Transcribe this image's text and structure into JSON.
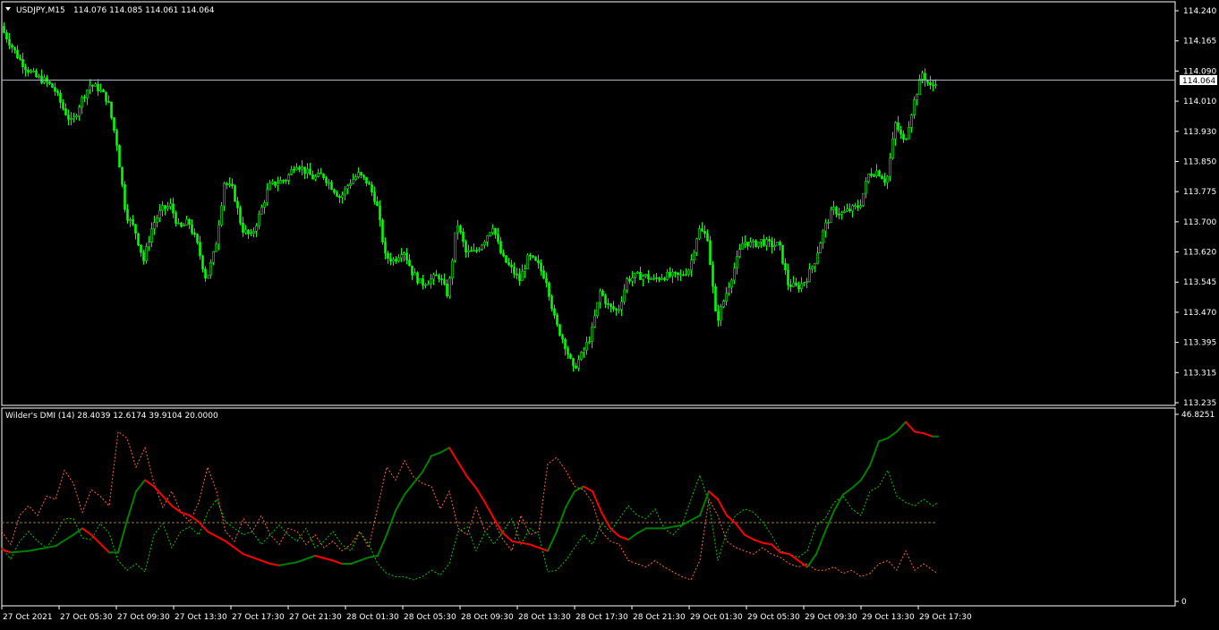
{
  "main_panel": {
    "symbol_label": "USDJPY,M15",
    "ohlc_label": "114.076 114.085 114.061 114.064",
    "current_price_label": "114.064",
    "price_axis_ticks": [
      "114.240",
      "114.165",
      "114.090",
      "114.010",
      "113.930",
      "113.850",
      "113.775",
      "113.700",
      "113.620",
      "113.545",
      "113.470",
      "113.395",
      "113.315",
      "113.235"
    ]
  },
  "indicator_panel": {
    "title": "Wilder's DMI (14) 28.4039 12.6174 39.9104 20.0000",
    "axis_ticks": [
      "46.8251",
      "0"
    ]
  },
  "time_axis": {
    "labels": [
      "27 Oct 2021",
      "27 Oct 05:30",
      "27 Oct 09:30",
      "27 Oct 13:30",
      "27 Oct 17:30",
      "27 Oct 21:30",
      "28 Oct 01:30",
      "28 Oct 05:30",
      "28 Oct 09:30",
      "28 Oct 13:30",
      "28 Oct 17:30",
      "28 Oct 21:30",
      "29 Oct 01:30",
      "29 Oct 05:30",
      "29 Oct 09:30",
      "29 Oct 13:30",
      "29 Oct 17:30"
    ]
  },
  "colors": {
    "background": "#000000",
    "frame": "#ffffff",
    "candle": "#00ff00",
    "adx_rising": "#008000",
    "adx_falling": "#ff0000",
    "plus_di": "#00cc00",
    "minus_di": "#ff6347",
    "level_line": "#8b7d3a"
  },
  "chart_data": {
    "type": "line",
    "close_path": [
      [
        0,
        114.2
      ],
      [
        10,
        114.16
      ],
      [
        20,
        114.12
      ],
      [
        30,
        114.09
      ],
      [
        40,
        114.07
      ],
      [
        50,
        114.06
      ],
      [
        60,
        114.04
      ],
      [
        70,
        113.99
      ],
      [
        80,
        113.95
      ],
      [
        90,
        114.01
      ],
      [
        100,
        114.05
      ],
      [
        110,
        114.04
      ],
      [
        120,
        114.01
      ],
      [
        130,
        113.9
      ],
      [
        140,
        113.72
      ],
      [
        150,
        113.68
      ],
      [
        160,
        113.6
      ],
      [
        170,
        113.69
      ],
      [
        180,
        113.73
      ],
      [
        190,
        113.74
      ],
      [
        200,
        113.68
      ],
      [
        210,
        113.7
      ],
      [
        220,
        113.64
      ],
      [
        230,
        113.55
      ],
      [
        240,
        113.63
      ],
      [
        250,
        113.8
      ],
      [
        260,
        113.78
      ],
      [
        270,
        113.68
      ],
      [
        280,
        113.66
      ],
      [
        290,
        113.72
      ],
      [
        300,
        113.79
      ],
      [
        310,
        113.8
      ],
      [
        320,
        113.81
      ],
      [
        330,
        113.85
      ],
      [
        340,
        113.83
      ],
      [
        350,
        113.81
      ],
      [
        360,
        113.82
      ],
      [
        370,
        113.79
      ],
      [
        380,
        113.76
      ],
      [
        390,
        113.8
      ],
      [
        400,
        113.82
      ],
      [
        410,
        113.8
      ],
      [
        420,
        113.75
      ],
      [
        430,
        113.61
      ],
      [
        440,
        113.6
      ],
      [
        450,
        113.63
      ],
      [
        460,
        113.57
      ],
      [
        470,
        113.54
      ],
      [
        480,
        113.55
      ],
      [
        490,
        113.56
      ],
      [
        500,
        113.51
      ],
      [
        510,
        113.7
      ],
      [
        520,
        113.62
      ],
      [
        530,
        113.62
      ],
      [
        540,
        113.65
      ],
      [
        550,
        113.69
      ],
      [
        560,
        113.61
      ],
      [
        570,
        113.58
      ],
      [
        580,
        113.55
      ],
      [
        590,
        113.61
      ],
      [
        600,
        113.59
      ],
      [
        610,
        113.55
      ],
      [
        620,
        113.44
      ],
      [
        630,
        113.39
      ],
      [
        640,
        113.32
      ],
      [
        650,
        113.36
      ],
      [
        660,
        113.41
      ],
      [
        670,
        113.52
      ],
      [
        680,
        113.48
      ],
      [
        690,
        113.47
      ],
      [
        700,
        113.55
      ],
      [
        710,
        113.56
      ],
      [
        720,
        113.56
      ],
      [
        730,
        113.55
      ],
      [
        740,
        113.56
      ],
      [
        750,
        113.56
      ],
      [
        760,
        113.56
      ],
      [
        770,
        113.58
      ],
      [
        780,
        113.68
      ],
      [
        790,
        113.66
      ],
      [
        800,
        113.44
      ],
      [
        810,
        113.51
      ],
      [
        820,
        113.58
      ],
      [
        830,
        113.65
      ],
      [
        840,
        113.64
      ],
      [
        850,
        113.65
      ],
      [
        860,
        113.64
      ],
      [
        870,
        113.64
      ],
      [
        880,
        113.54
      ],
      [
        890,
        113.53
      ],
      [
        900,
        113.55
      ],
      [
        910,
        113.6
      ],
      [
        920,
        113.68
      ],
      [
        930,
        113.73
      ],
      [
        940,
        113.72
      ],
      [
        950,
        113.73
      ],
      [
        960,
        113.74
      ],
      [
        970,
        113.82
      ],
      [
        980,
        113.83
      ],
      [
        990,
        113.8
      ],
      [
        1000,
        113.95
      ],
      [
        1010,
        113.9
      ],
      [
        1020,
        114.0
      ],
      [
        1030,
        114.08
      ],
      [
        1040,
        114.04
      ],
      [
        1046,
        114.064
      ]
    ],
    "adx": [
      [
        0,
        0.19
      ],
      [
        10,
        0.17
      ],
      [
        30,
        0.18
      ],
      [
        60,
        0.21
      ],
      [
        80,
        0.28
      ],
      [
        90,
        0.32
      ],
      [
        100,
        0.28
      ],
      [
        120,
        0.17
      ],
      [
        130,
        0.17
      ],
      [
        140,
        0.37
      ],
      [
        150,
        0.55
      ],
      [
        160,
        0.62
      ],
      [
        170,
        0.58
      ],
      [
        180,
        0.52
      ],
      [
        190,
        0.46
      ],
      [
        200,
        0.42
      ],
      [
        210,
        0.4
      ],
      [
        220,
        0.36
      ],
      [
        230,
        0.3
      ],
      [
        250,
        0.24
      ],
      [
        270,
        0.16
      ],
      [
        290,
        0.12
      ],
      [
        300,
        0.1
      ],
      [
        310,
        0.09
      ],
      [
        330,
        0.11
      ],
      [
        350,
        0.15
      ],
      [
        370,
        0.12
      ],
      [
        380,
        0.1
      ],
      [
        390,
        0.1
      ],
      [
        410,
        0.14
      ],
      [
        420,
        0.15
      ],
      [
        430,
        0.28
      ],
      [
        440,
        0.43
      ],
      [
        450,
        0.53
      ],
      [
        460,
        0.6
      ],
      [
        470,
        0.67
      ],
      [
        480,
        0.77
      ],
      [
        490,
        0.79
      ],
      [
        500,
        0.82
      ],
      [
        510,
        0.73
      ],
      [
        520,
        0.64
      ],
      [
        530,
        0.57
      ],
      [
        540,
        0.48
      ],
      [
        550,
        0.38
      ],
      [
        560,
        0.29
      ],
      [
        570,
        0.24
      ],
      [
        590,
        0.22
      ],
      [
        600,
        0.2
      ],
      [
        610,
        0.18
      ],
      [
        620,
        0.3
      ],
      [
        630,
        0.45
      ],
      [
        640,
        0.55
      ],
      [
        650,
        0.58
      ],
      [
        660,
        0.55
      ],
      [
        670,
        0.42
      ],
      [
        680,
        0.32
      ],
      [
        690,
        0.27
      ],
      [
        700,
        0.25
      ],
      [
        710,
        0.29
      ],
      [
        720,
        0.32
      ],
      [
        740,
        0.32
      ],
      [
        760,
        0.34
      ],
      [
        780,
        0.4
      ],
      [
        790,
        0.55
      ],
      [
        800,
        0.5
      ],
      [
        810,
        0.4
      ],
      [
        820,
        0.35
      ],
      [
        830,
        0.28
      ],
      [
        840,
        0.25
      ],
      [
        850,
        0.23
      ],
      [
        860,
        0.22
      ],
      [
        870,
        0.17
      ],
      [
        880,
        0.16
      ],
      [
        890,
        0.12
      ],
      [
        900,
        0.08
      ],
      [
        910,
        0.16
      ],
      [
        920,
        0.3
      ],
      [
        930,
        0.43
      ],
      [
        940,
        0.53
      ],
      [
        950,
        0.57
      ],
      [
        960,
        0.62
      ],
      [
        970,
        0.71
      ],
      [
        980,
        0.86
      ],
      [
        990,
        0.88
      ],
      [
        1000,
        0.92
      ],
      [
        1010,
        0.98
      ],
      [
        1020,
        0.92
      ],
      [
        1030,
        0.91
      ],
      [
        1040,
        0.89
      ],
      [
        1046,
        0.89
      ]
    ],
    "plus_di": [
      [
        0,
        0.2
      ],
      [
        10,
        0.13
      ],
      [
        20,
        0.24
      ],
      [
        30,
        0.3
      ],
      [
        40,
        0.24
      ],
      [
        50,
        0.2
      ],
      [
        60,
        0.28
      ],
      [
        70,
        0.38
      ],
      [
        80,
        0.38
      ],
      [
        90,
        0.26
      ],
      [
        100,
        0.25
      ],
      [
        110,
        0.35
      ],
      [
        120,
        0.29
      ],
      [
        130,
        0.12
      ],
      [
        140,
        0.06
      ],
      [
        150,
        0.1
      ],
      [
        160,
        0.05
      ],
      [
        170,
        0.28
      ],
      [
        180,
        0.35
      ],
      [
        190,
        0.2
      ],
      [
        200,
        0.3
      ],
      [
        210,
        0.33
      ],
      [
        220,
        0.28
      ],
      [
        230,
        0.42
      ],
      [
        240,
        0.5
      ],
      [
        250,
        0.36
      ],
      [
        260,
        0.32
      ],
      [
        270,
        0.28
      ],
      [
        280,
        0.3
      ],
      [
        290,
        0.22
      ],
      [
        300,
        0.28
      ],
      [
        310,
        0.34
      ],
      [
        320,
        0.28
      ],
      [
        330,
        0.24
      ],
      [
        340,
        0.32
      ],
      [
        350,
        0.2
      ],
      [
        360,
        0.24
      ],
      [
        370,
        0.3
      ],
      [
        380,
        0.22
      ],
      [
        390,
        0.18
      ],
      [
        400,
        0.3
      ],
      [
        410,
        0.22
      ],
      [
        420,
        0.1
      ],
      [
        430,
        0.04
      ],
      [
        440,
        0.02
      ],
      [
        450,
        0.02
      ],
      [
        460,
        0.0
      ],
      [
        470,
        0.02
      ],
      [
        480,
        0.06
      ],
      [
        490,
        0.03
      ],
      [
        500,
        0.1
      ],
      [
        510,
        0.3
      ],
      [
        520,
        0.33
      ],
      [
        530,
        0.18
      ],
      [
        540,
        0.3
      ],
      [
        550,
        0.22
      ],
      [
        560,
        0.3
      ],
      [
        570,
        0.38
      ],
      [
        580,
        0.22
      ],
      [
        590,
        0.32
      ],
      [
        600,
        0.28
      ],
      [
        610,
        0.05
      ],
      [
        620,
        0.06
      ],
      [
        630,
        0.12
      ],
      [
        640,
        0.2
      ],
      [
        650,
        0.28
      ],
      [
        660,
        0.22
      ],
      [
        670,
        0.35
      ],
      [
        680,
        0.3
      ],
      [
        690,
        0.38
      ],
      [
        700,
        0.46
      ],
      [
        710,
        0.4
      ],
      [
        720,
        0.38
      ],
      [
        730,
        0.44
      ],
      [
        740,
        0.32
      ],
      [
        750,
        0.28
      ],
      [
        760,
        0.34
      ],
      [
        770,
        0.5
      ],
      [
        780,
        0.65
      ],
      [
        790,
        0.48
      ],
      [
        800,
        0.12
      ],
      [
        810,
        0.3
      ],
      [
        820,
        0.4
      ],
      [
        830,
        0.44
      ],
      [
        840,
        0.42
      ],
      [
        850,
        0.36
      ],
      [
        860,
        0.28
      ],
      [
        870,
        0.18
      ],
      [
        880,
        0.16
      ],
      [
        890,
        0.14
      ],
      [
        900,
        0.18
      ],
      [
        910,
        0.34
      ],
      [
        920,
        0.38
      ],
      [
        930,
        0.48
      ],
      [
        940,
        0.52
      ],
      [
        950,
        0.44
      ],
      [
        960,
        0.4
      ],
      [
        970,
        0.55
      ],
      [
        980,
        0.58
      ],
      [
        990,
        0.68
      ],
      [
        1000,
        0.52
      ],
      [
        1010,
        0.48
      ],
      [
        1020,
        0.46
      ],
      [
        1030,
        0.5
      ],
      [
        1040,
        0.46
      ],
      [
        1046,
        0.48
      ]
    ],
    "minus_di": [
      [
        0,
        0.3
      ],
      [
        10,
        0.22
      ],
      [
        20,
        0.4
      ],
      [
        30,
        0.46
      ],
      [
        40,
        0.4
      ],
      [
        50,
        0.52
      ],
      [
        60,
        0.5
      ],
      [
        70,
        0.68
      ],
      [
        80,
        0.6
      ],
      [
        90,
        0.42
      ],
      [
        100,
        0.56
      ],
      [
        110,
        0.52
      ],
      [
        120,
        0.46
      ],
      [
        130,
        0.92
      ],
      [
        140,
        0.88
      ],
      [
        150,
        0.7
      ],
      [
        160,
        0.82
      ],
      [
        170,
        0.6
      ],
      [
        180,
        0.45
      ],
      [
        190,
        0.55
      ],
      [
        200,
        0.42
      ],
      [
        210,
        0.36
      ],
      [
        220,
        0.48
      ],
      [
        230,
        0.7
      ],
      [
        240,
        0.55
      ],
      [
        250,
        0.3
      ],
      [
        260,
        0.24
      ],
      [
        270,
        0.38
      ],
      [
        280,
        0.3
      ],
      [
        290,
        0.4
      ],
      [
        300,
        0.28
      ],
      [
        310,
        0.22
      ],
      [
        320,
        0.32
      ],
      [
        330,
        0.3
      ],
      [
        340,
        0.22
      ],
      [
        350,
        0.28
      ],
      [
        360,
        0.2
      ],
      [
        370,
        0.24
      ],
      [
        380,
        0.18
      ],
      [
        390,
        0.22
      ],
      [
        400,
        0.3
      ],
      [
        410,
        0.2
      ],
      [
        420,
        0.45
      ],
      [
        430,
        0.7
      ],
      [
        440,
        0.62
      ],
      [
        450,
        0.74
      ],
      [
        460,
        0.64
      ],
      [
        470,
        0.6
      ],
      [
        480,
        0.58
      ],
      [
        490,
        0.44
      ],
      [
        500,
        0.55
      ],
      [
        510,
        0.32
      ],
      [
        520,
        0.28
      ],
      [
        530,
        0.45
      ],
      [
        540,
        0.3
      ],
      [
        550,
        0.36
      ],
      [
        560,
        0.25
      ],
      [
        570,
        0.18
      ],
      [
        580,
        0.4
      ],
      [
        590,
        0.28
      ],
      [
        600,
        0.3
      ],
      [
        610,
        0.72
      ],
      [
        620,
        0.76
      ],
      [
        630,
        0.68
      ],
      [
        640,
        0.58
      ],
      [
        650,
        0.56
      ],
      [
        660,
        0.48
      ],
      [
        670,
        0.3
      ],
      [
        680,
        0.24
      ],
      [
        690,
        0.22
      ],
      [
        700,
        0.12
      ],
      [
        710,
        0.1
      ],
      [
        720,
        0.08
      ],
      [
        730,
        0.12
      ],
      [
        740,
        0.08
      ],
      [
        750,
        0.05
      ],
      [
        760,
        0.02
      ],
      [
        770,
        0.0
      ],
      [
        780,
        0.12
      ],
      [
        790,
        0.5
      ],
      [
        800,
        0.4
      ],
      [
        810,
        0.24
      ],
      [
        820,
        0.2
      ],
      [
        830,
        0.18
      ],
      [
        840,
        0.16
      ],
      [
        850,
        0.2
      ],
      [
        860,
        0.16
      ],
      [
        870,
        0.14
      ],
      [
        880,
        0.1
      ],
      [
        890,
        0.08
      ],
      [
        900,
        0.1
      ],
      [
        910,
        0.06
      ],
      [
        920,
        0.06
      ],
      [
        930,
        0.08
      ],
      [
        940,
        0.04
      ],
      [
        950,
        0.06
      ],
      [
        960,
        0.02
      ],
      [
        970,
        0.04
      ],
      [
        980,
        0.1
      ],
      [
        990,
        0.12
      ],
      [
        1000,
        0.06
      ],
      [
        1010,
        0.18
      ],
      [
        1020,
        0.06
      ],
      [
        1030,
        0.1
      ],
      [
        1040,
        0.06
      ],
      [
        1046,
        0.04
      ]
    ]
  }
}
